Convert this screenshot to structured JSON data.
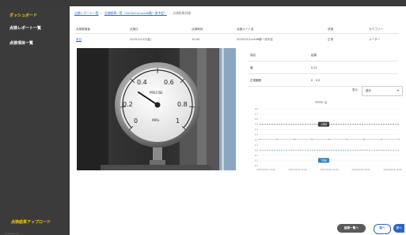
{
  "sidebar": {
    "brand": "ダッシュボード",
    "items": [
      {
        "label": "点検レポート一覧"
      },
      {
        "label": "点検項目一覧"
      }
    ],
    "bottom_link": "点検結果アップロード",
    "powered": "powered by ..."
  },
  "breadcrumb": {
    "items": [
      "点検レポート一覧",
      "点検結果一覧（2025/01/Lucid8階一流予定）",
      "点検結果詳細"
    ]
  },
  "record_table": {
    "headers": [
      "点検実施者",
      "点検日",
      "点検時刻",
      "点検ルート名",
      "状態",
      "カテゴリー"
    ],
    "row": [
      "本日",
      "2025/12/12(金)",
      "15:45",
      "2025/01/Lucid8階一流予定",
      "正常",
      "メーター"
    ]
  },
  "measurement": {
    "header_label": "項目",
    "header_value": "結果",
    "rows": [
      {
        "label": "値",
        "value": "0.21"
      },
      {
        "label": "正常範囲",
        "value": "0 - 0.5"
      }
    ]
  },
  "period": {
    "label": "表示",
    "selected": "過去"
  },
  "chart_data": {
    "type": "line",
    "legend": "値",
    "ytick_labels": [
      "0.8",
      "0.7",
      "0.6",
      "0.5",
      "0.4",
      "0.3",
      "0.2",
      "0.1",
      "0.0",
      "-0.1",
      "-0.2",
      "-0.3"
    ],
    "xtick_labels": [
      "2025/01/16 10:00",
      "2025/01/16 12:00",
      "2025/01/16 14:00",
      "2025/01/16 16:00",
      "2025/01/16 18:00"
    ],
    "upper_limit": {
      "label": "上限値",
      "value": 0.5
    },
    "lower_limit": {
      "label": "下限値",
      "value": 0.0
    },
    "series": [
      {
        "values": [
          0.21,
          0.21,
          0.21,
          0.21,
          0.21,
          0.21,
          0.21,
          0.21,
          0.21
        ]
      }
    ],
    "ylim": [
      -0.3,
      0.8
    ]
  },
  "buttons": {
    "list": "結果一覧へ",
    "prev": "前へ",
    "next": "次へ"
  },
  "gauge": {
    "scale": [
      "0",
      "0.2",
      "0.4",
      "0.6",
      "0.8",
      "1"
    ],
    "brand": "PRECISE",
    "unit": "MPa"
  },
  "colors": {
    "sidebar_bg": "#3b3b3b",
    "brand_yellow": "#f3c613",
    "link_blue": "#2e64c8",
    "limit_dark": "#3a3a3a",
    "limit_blue": "#2f7fb8"
  }
}
